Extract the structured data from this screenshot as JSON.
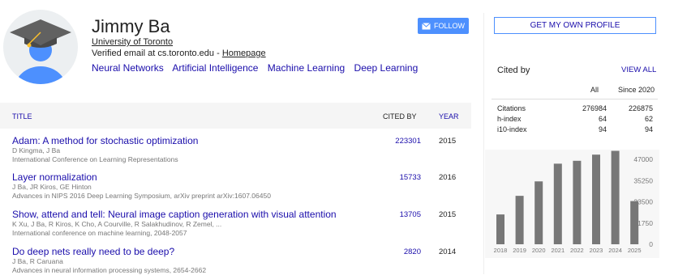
{
  "profile": {
    "name": "Jimmy Ba",
    "affiliation": "University of Toronto",
    "email_text": "Verified email at cs.toronto.edu - ",
    "homepage": "Homepage",
    "interests": [
      "Neural Networks",
      "Artificial Intelligence",
      "Machine Learning",
      "Deep Learning"
    ],
    "follow_label": "FOLLOW",
    "get_profile_label": "GET MY OWN PROFILE"
  },
  "table": {
    "headers": {
      "title": "TITLE",
      "cited_by": "CITED BY",
      "year": "YEAR"
    },
    "rows": [
      {
        "title": "Adam: A method for stochastic optimization",
        "authors": "D Kingma, J Ba",
        "venue": "International Conference on Learning Representations",
        "cited": "223301",
        "year": "2015"
      },
      {
        "title": "Layer normalization",
        "authors": "J Ba, JR Kiros, GE Hinton",
        "venue": "Advances in NIPS 2016 Deep Learning Symposium, arXiv preprint arXiv:1607.06450",
        "cited": "15733",
        "year": "2016"
      },
      {
        "title": "Show, attend and tell: Neural image caption generation with visual attention",
        "authors": "K Xu, J Ba, R Kiros, K Cho, A Courville, R Salakhudinov, R Zemel, ...",
        "venue": "International conference on machine learning, 2048-2057",
        "cited": "13705",
        "year": "2015"
      },
      {
        "title": "Do deep nets really need to be deep?",
        "authors": "J Ba, R Caruana",
        "venue": "Advances in neural information processing systems, 2654-2662",
        "cited": "2820",
        "year": "2014"
      }
    ]
  },
  "citations": {
    "header": "Cited by",
    "view_all": "VIEW ALL",
    "col_all": "All",
    "col_since": "Since 2020",
    "stats": [
      {
        "label": "Citations",
        "all": "276984",
        "since": "226875"
      },
      {
        "label": "h-index",
        "all": "64",
        "since": "62"
      },
      {
        "label": "i10-index",
        "all": "94",
        "since": "94"
      }
    ]
  },
  "chart_data": {
    "type": "bar",
    "categories": [
      "2018",
      "2019",
      "2020",
      "2021",
      "2022",
      "2023",
      "2024",
      "2025"
    ],
    "values": [
      16500,
      26800,
      34800,
      44600,
      46200,
      49600,
      51800,
      23900
    ],
    "yticks": [
      "47000",
      "35250",
      "23500",
      "11750",
      "0"
    ],
    "ylim": [
      0,
      47000
    ],
    "bar_color": "#777777"
  },
  "colors": {
    "link": "#1a0dab",
    "accent": "#4d90fe"
  }
}
